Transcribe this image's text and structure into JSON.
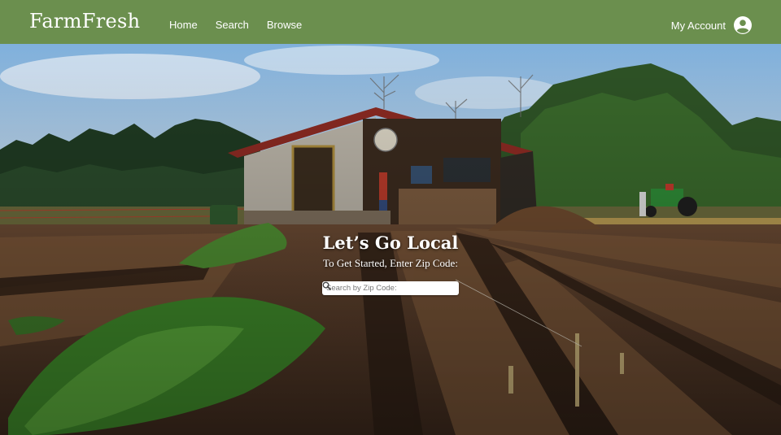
{
  "header": {
    "logo": "FarmFresh",
    "nav": [
      {
        "label": "Home"
      },
      {
        "label": "Search"
      },
      {
        "label": "Browse"
      }
    ],
    "account_label": "My Account",
    "account_icon": "user-avatar-icon"
  },
  "hero": {
    "headline": "Let’s Go Local",
    "subline": "To Get Started, Enter Zip Code:",
    "search": {
      "placeholder": "Search by Zip Code:",
      "value": "",
      "icon": "search-icon"
    }
  },
  "colors": {
    "header_bg": "#6b8f4e",
    "text": "#ffffff",
    "sky": "#8fb7dd",
    "soil": "#5a3e2b",
    "greens": "#3f8a2a"
  }
}
